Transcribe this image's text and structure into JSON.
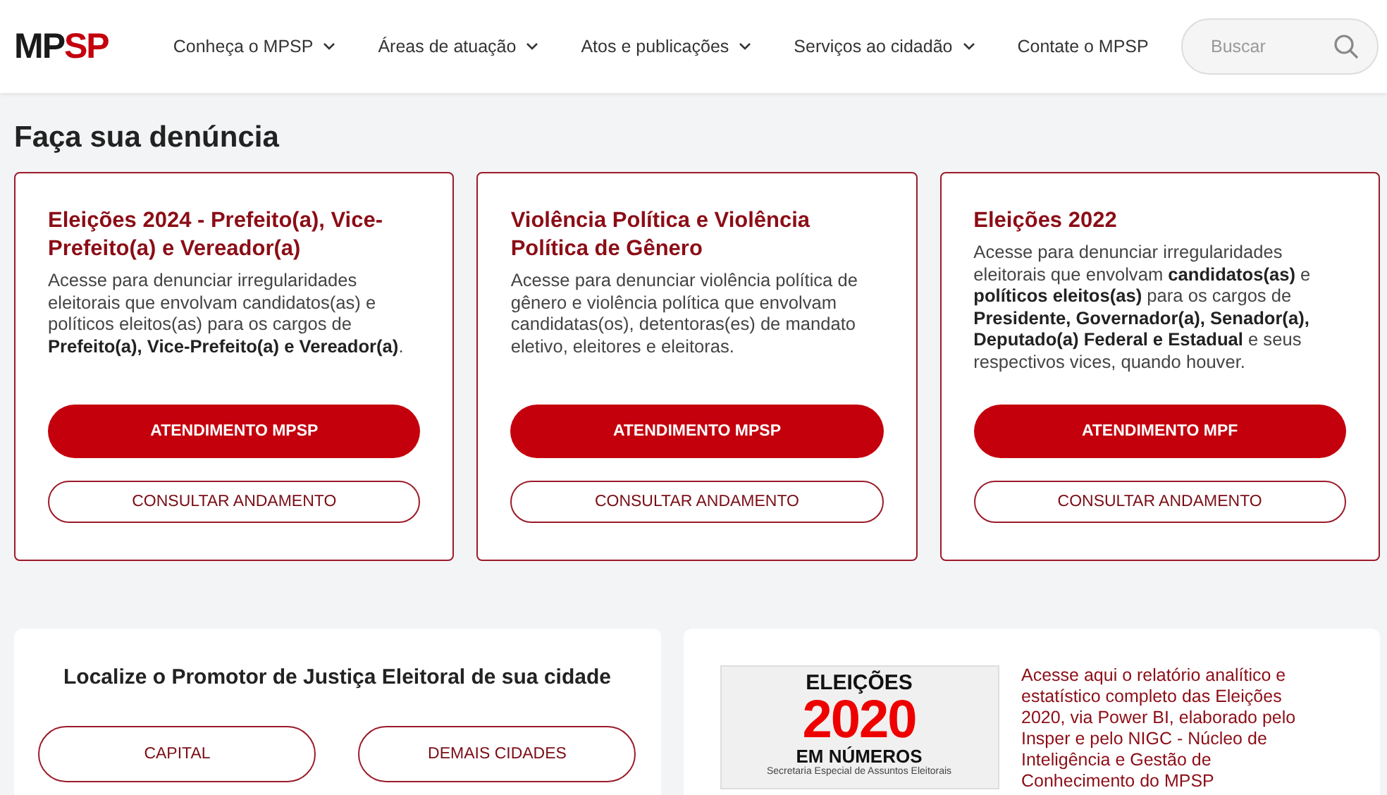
{
  "header": {
    "logo": {
      "part_1": "MP",
      "part_2": "SP"
    },
    "nav": [
      {
        "label": "Conheça o MPSP",
        "dropdown": true
      },
      {
        "label": "Áreas de atuação",
        "dropdown": true
      },
      {
        "label": "Atos e publicações",
        "dropdown": true
      },
      {
        "label": "Serviços ao cidadão",
        "dropdown": true
      },
      {
        "label": "Contate o MPSP",
        "dropdown": false
      }
    ],
    "search": {
      "placeholder": "Buscar"
    }
  },
  "page_title": "Faça sua denúncia",
  "cards": [
    {
      "title": "Eleições 2024 - Prefeito(a), Vice-Prefeito(a) e Vereador(a)",
      "description": "Acesse para denunciar irregularidades eleitorais que envolvam candidatos(as) e políticos eleitos(as) para os cargos de **Prefeito(a), Vice-Prefeito(a) e Vereador(a)**.",
      "primary_button": "ATENDIMENTO MPSP",
      "secondary_button": "CONSULTAR ANDAMENTO"
    },
    {
      "title": "Violência Política e Violência Política de Gênero",
      "description": "Acesse para denunciar violência política de gênero e violência política que envolvam candidatas(os), detentoras(es) de mandato eletivo, eleitores e eleitoras.",
      "primary_button": "ATENDIMENTO MPSP",
      "secondary_button": "CONSULTAR ANDAMENTO"
    },
    {
      "title": "Eleições 2022",
      "description": "Acesse para denunciar irregularidades eleitorais que envolvam **candidatos(as)** e **políticos eleitos(as)** para os cargos de **Presidente, Governador(a), Senador(a), Deputado(a) Federal e Estadual** e seus respectivos vices, quando houver.",
      "primary_button": "ATENDIMENTO MPF",
      "secondary_button": "CONSULTAR ANDAMENTO"
    }
  ],
  "promotor_panel": {
    "title": "Localize o Promotor de Justiça Eleitoral de sua cidade",
    "buttons": [
      "CAPITAL",
      "DEMAIS CIDADES"
    ]
  },
  "report_panel": {
    "banner": {
      "line_1": "ELEIÇÕES",
      "line_2": "2020",
      "line_3": "EM NÚMEROS",
      "line_4": "Secretaria Especial de Assuntos Eleitorais"
    },
    "text": "Acesse aqui o relatório analítico e estatístico completo das Eleições 2020, via Power BI, elaborado pelo Insper e pelo NIGC - Núcleo de Inteligência e Gestão de Conhecimento do MPSP"
  }
}
